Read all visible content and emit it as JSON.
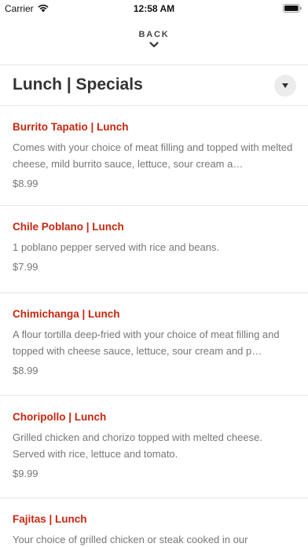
{
  "status_bar": {
    "carrier": "Carrier",
    "time": "12:58 AM"
  },
  "nav": {
    "back_label": "BACK"
  },
  "section": {
    "title": "Lunch | Specials"
  },
  "menu_items": [
    {
      "name": "Burrito Tapatio | Lunch",
      "description": "Comes with your choice of meat filling and topped with melted cheese, mild burrito sauce, lettuce, sour cream a…",
      "price": "$8.99"
    },
    {
      "name": "Chile Poblano | Lunch",
      "description": "1 poblano pepper served with rice and beans.",
      "price": "$7.99"
    },
    {
      "name": "Chimichanga | Lunch",
      "description": "A flour tortilla deep-fried with your choice of meat filling and topped with cheese sauce, lettuce, sour cream and p…",
      "price": "$8.99"
    },
    {
      "name": "Choripollo | Lunch",
      "description": "Grilled chicken and chorizo topped with melted cheese. Served with rice, lettuce and tomato.",
      "price": "$9.99"
    },
    {
      "name": "Fajitas | Lunch",
      "description": "Your choice of grilled chicken or steak cooked in our",
      "price": ""
    }
  ],
  "colors": {
    "item_name": "#c8260e",
    "text_muted": "#777777",
    "divider": "#e6e6e6"
  },
  "icons": [
    "wifi-icon",
    "battery-icon",
    "chevron-down-icon",
    "dropdown-triangle-icon"
  ]
}
